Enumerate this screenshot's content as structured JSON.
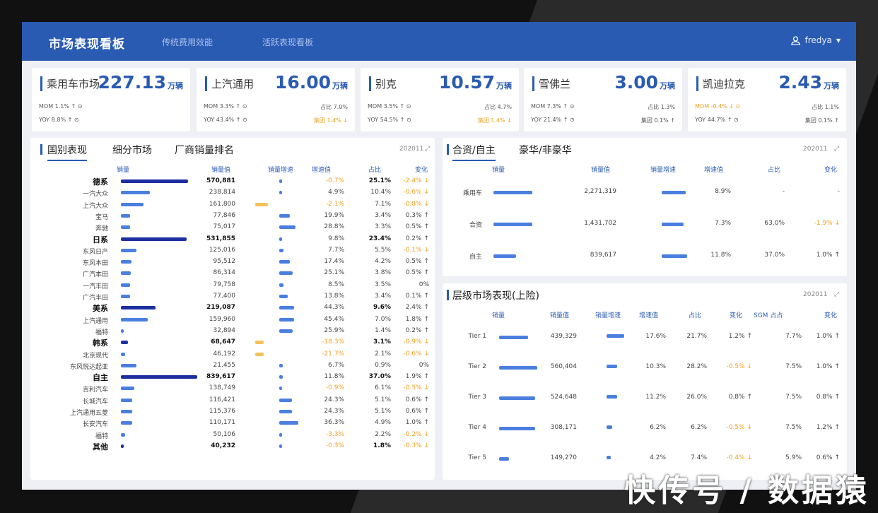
{
  "header": {
    "title": "市场表现看板",
    "nav": [
      "传统费用效能",
      "活跃表现看板"
    ],
    "user": "fredya"
  },
  "kpis": [
    {
      "name": "乘用车市场",
      "value": "227.13",
      "unit": "万辆",
      "lines": [
        "MOM 1.1% ↑ ⊙",
        "YOY 8.8% ↑ ⊙"
      ],
      "right": [
        "",
        ""
      ]
    },
    {
      "name": "上汽通用",
      "value": "16.00",
      "unit": "万辆",
      "lines": [
        "MOM 3.3% ↑ ⊙",
        "YOY 43.4% ↑ ⊙"
      ],
      "right": [
        "占比 7.0%",
        "集团 1.4% ↓"
      ]
    },
    {
      "name": "别克",
      "value": "10.57",
      "unit": "万辆",
      "lines": [
        "MOM 3.5% ↑ ⊙",
        "YOY 54.5% ↑ ⊙"
      ],
      "right": [
        "占比 4.7%",
        "集团 1.4% ↓"
      ]
    },
    {
      "name": "雪佛兰",
      "value": "3.00",
      "unit": "万辆",
      "lines": [
        "MOM 7.3% ↑ ⊙",
        "YOY 21.4% ↑ ⊙"
      ],
      "right": [
        "占比 1.3%",
        "集团 0.1% ↑"
      ]
    },
    {
      "name": "凯迪拉克",
      "value": "2.43",
      "unit": "万辆",
      "lines": [
        "MOM -0.4% ↓ ⊙",
        "YOY 44.7% ↑ ⊙"
      ],
      "right": [
        "占比 1.1%",
        "集团 0.1% ↑"
      ]
    }
  ],
  "left_panel": {
    "tabs": [
      "国别表现",
      "细分市场",
      "厂商销量排名"
    ],
    "date": "202011",
    "headers": [
      "销量",
      "销量值",
      "销量增速",
      "增速值",
      "占比",
      "变化"
    ],
    "rows": [
      {
        "label": "德系",
        "bold": true,
        "bar": 0.88,
        "dark": true,
        "val": "570,881",
        "g": "",
        "gbar": 0,
        "gor": false,
        "gv": "-0.7%",
        "gvor": true,
        "share": "25.1%",
        "chg": "-2.4% ↓",
        "chgor": true
      },
      {
        "label": "一汽大众",
        "bar": 0.38,
        "val": "238,814",
        "gbar": 0.02,
        "gor": false,
        "gv": "4.9%",
        "share": "10.4%",
        "chg": "-0.6% ↓",
        "chgor": true
      },
      {
        "label": "上汽大众",
        "bar": 0.3,
        "val": "161,800",
        "gbar": 0.3,
        "gor": true,
        "gv": "-2.1%",
        "gvor": true,
        "share": "7.1%",
        "chg": "-0.8% ↓",
        "chgor": true
      },
      {
        "label": "宝马",
        "bar": 0.12,
        "val": "77,846",
        "gbar": 0.25,
        "gv": "19.9%",
        "share": "3.4%",
        "chg": "0.3% ↑"
      },
      {
        "label": "奔驰",
        "bar": 0.12,
        "val": "75,017",
        "gbar": 0.38,
        "gv": "28.8%",
        "share": "3.3%",
        "chg": "0.5% ↑"
      },
      {
        "label": "日系",
        "bold": true,
        "bar": 0.86,
        "dark": true,
        "val": "531,855",
        "gbar": 0.0,
        "gv": "9.8%",
        "share": "23.4%",
        "chg": "0.2% ↑"
      },
      {
        "label": "东风日产",
        "bar": 0.2,
        "val": "125,016",
        "gbar": 0.1,
        "gv": "7.7%",
        "share": "5.5%",
        "chg": "-0.1% ↓",
        "chgor": true
      },
      {
        "label": "东风本田",
        "bar": 0.14,
        "val": "95,512",
        "gbar": 0.25,
        "gv": "17.4%",
        "share": "4.2%",
        "chg": "0.5% ↑"
      },
      {
        "label": "广汽本田",
        "bar": 0.13,
        "val": "86,314",
        "gbar": 0.32,
        "gv": "25.1%",
        "share": "3.8%",
        "chg": "0.5% ↑"
      },
      {
        "label": "一汽丰田",
        "bar": 0.12,
        "val": "79,758",
        "gbar": 0.1,
        "gv": "8.5%",
        "share": "3.5%",
        "chg": "0%"
      },
      {
        "label": "广汽丰田",
        "bar": 0.12,
        "val": "77,400",
        "gbar": 0.2,
        "gv": "13.8%",
        "share": "3.4%",
        "chg": "0.1% ↑"
      },
      {
        "label": "美系",
        "bold": true,
        "bar": 0.45,
        "dark": true,
        "val": "219,087",
        "gbar": 0.35,
        "gv": "44.3%",
        "share": "9.6%",
        "chg": "2.4% ↑"
      },
      {
        "label": "上汽通用",
        "bar": 0.35,
        "val": "159,960",
        "gbar": 0.35,
        "gv": "45.4%",
        "share": "7.0%",
        "chg": "1.8% ↑"
      },
      {
        "label": "福特",
        "bar": 0.04,
        "val": "32,894",
        "gbar": 0.32,
        "gv": "25.9%",
        "share": "1.4%",
        "chg": "0.2% ↑"
      },
      {
        "label": "韩系",
        "bold": true,
        "bar": 0.09,
        "dark": true,
        "val": "68,647",
        "gbar": 0.2,
        "gor": true,
        "gv": "-18.3%",
        "gvor": true,
        "share": "3.1%",
        "chg": "-0.9% ↓",
        "chgor": true
      },
      {
        "label": "北京现代",
        "bar": 0.06,
        "val": "46,192",
        "gbar": 0.2,
        "gor": true,
        "gv": "-21.7%",
        "gvor": true,
        "share": "2.1%",
        "chg": "-0.6% ↓",
        "chgor": true
      },
      {
        "label": "东风悦达起亚",
        "bar": 0.2,
        "val": "21,455",
        "gbar": 0.08,
        "gv": "6.7%",
        "share": "0.9%",
        "chg": "0%"
      },
      {
        "label": "自主",
        "bold": true,
        "bar": 1.0,
        "dark": true,
        "val": "839,617",
        "gbar": 0.08,
        "gv": "11.8%",
        "share": "37.0%",
        "chg": "1.9% ↑"
      },
      {
        "label": "吉利汽车",
        "bar": 0.18,
        "val": "138,749",
        "gbar": 0.0,
        "gv": "-0.9%",
        "gvor": true,
        "share": "6.1%",
        "chg": "-0.5% ↓",
        "chgor": true
      },
      {
        "label": "长城汽车",
        "bar": 0.15,
        "val": "116,421",
        "gbar": 0.3,
        "gv": "24.3%",
        "share": "5.1%",
        "chg": "0.6% ↑"
      },
      {
        "label": "上汽通用五菱",
        "bar": 0.15,
        "val": "115,376",
        "gbar": 0.3,
        "gv": "24.3%",
        "share": "5.1%",
        "chg": "0.6% ↑"
      },
      {
        "label": "长安汽车",
        "bar": 0.15,
        "val": "110,171",
        "gbar": 0.45,
        "gv": "36.3%",
        "share": "4.9%",
        "chg": "1.0% ↑"
      },
      {
        "label": "福特",
        "bar": 0.06,
        "val": "50,106",
        "gbar": 0.0,
        "gv": "-3.3%",
        "gvor": true,
        "share": "2.2%",
        "chg": "-0.2% ↓",
        "chgor": true
      },
      {
        "label": "其他",
        "bold": true,
        "bar": 0.04,
        "dark": true,
        "val": "40,232",
        "gbar": 0.0,
        "gv": "-0.3%",
        "gvor": true,
        "share": "1.8%",
        "chg": "-0.3% ↓",
        "chgor": true
      }
    ]
  },
  "right_top": {
    "tabs": [
      "合资/自主",
      "豪华/非豪华"
    ],
    "date": "202011",
    "headers": [
      "销量",
      "销量值",
      "销量增速",
      "增速值",
      "占比",
      "变化"
    ],
    "rows": [
      {
        "label": "乘用车",
        "bar": 0.95,
        "val": "2,271,319",
        "gbar": 0.95,
        "gv": "8.9%",
        "share": "-",
        "chg": "-"
      },
      {
        "label": "合资",
        "bar": 0.95,
        "val": "1,431,702",
        "gbar": 0.85,
        "gv": "7.3%",
        "share": "63.0%",
        "chg": "-1.9% ↓",
        "chgor": true
      },
      {
        "label": "自主",
        "bar": 0.55,
        "val": "839,617",
        "gbar": 1.0,
        "gv": "11.8%",
        "share": "37.0%",
        "chg": "1.0% ↑"
      }
    ]
  },
  "right_bottom": {
    "title": "层级市场表现(上险)",
    "date": "202011",
    "headers": [
      "销量",
      "销量值",
      "销量增速",
      "增速值",
      "占比",
      "变化",
      "SGM 占占",
      "变化"
    ],
    "rows": [
      {
        "label": "Tier 1",
        "bar": 0.75,
        "val": "439,329",
        "gbar": 0.9,
        "gv": "17.6%",
        "share": "21.7%",
        "chg": "1.2% ↑",
        "sgm": "7.7%",
        "chg2": "1.0% ↑"
      },
      {
        "label": "Tier 2",
        "bar": 1.0,
        "val": "560,404",
        "gbar": 0.55,
        "gv": "10.3%",
        "share": "28.2%",
        "chg": "-0.5% ↓",
        "chgor": true,
        "sgm": "7.5%",
        "chg2": "1.0% ↑"
      },
      {
        "label": "Tier 3",
        "bar": 0.95,
        "val": "524,648",
        "gbar": 0.55,
        "gv": "11.2%",
        "share": "26.0%",
        "chg": "0.8% ↑",
        "sgm": "7.5%",
        "chg2": "0.8% ↑"
      },
      {
        "label": "Tier 4",
        "bar": 0.95,
        "val": "308,171",
        "gbar": 0.3,
        "gv": "6.2%",
        "share": "6.2%",
        "chg": "-0.5% ↓",
        "chgor": true,
        "sgm": "7.5%",
        "chg2": "1.2% ↑"
      },
      {
        "label": "Tier 5",
        "bar": 0.25,
        "val": "149,270",
        "gbar": 0.2,
        "gv": "4.2%",
        "share": "7.4%",
        "chg": "-0.4% ↓",
        "chgor": true,
        "sgm": "5.9%",
        "chg2": "0.6% ↑"
      }
    ]
  },
  "watermark": "快传号 / 数据猿"
}
